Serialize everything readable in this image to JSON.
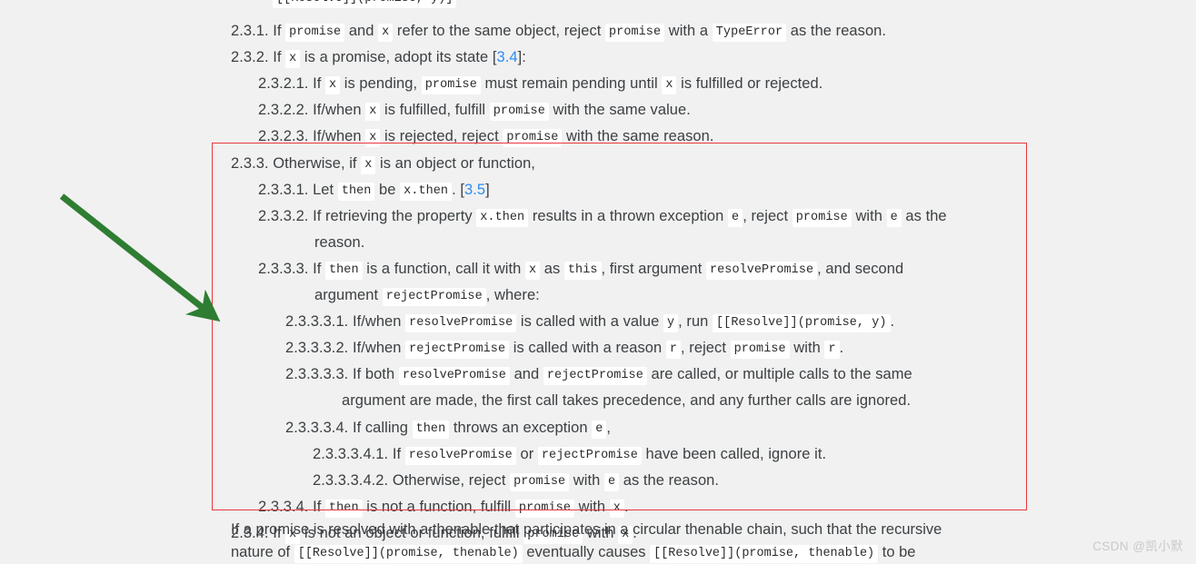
{
  "document": {
    "background_color": "#f1f1f1",
    "text_color": "#3c4043",
    "link_color": "#2e8bf0",
    "code_chip_bg": "#ffffff"
  },
  "cut_top_line": {
    "text_fragment": "[[Resolve]](promise, y)]"
  },
  "spec_items": [
    {
      "id": "2.3.1",
      "indent": 1,
      "number": "2.3.1.",
      "parts": [
        {
          "t": "text",
          "v": "If "
        },
        {
          "t": "code",
          "v": "promise"
        },
        {
          "t": "text",
          "v": " and "
        },
        {
          "t": "code",
          "v": "x"
        },
        {
          "t": "text",
          "v": " refer to the same object, reject "
        },
        {
          "t": "code",
          "v": "promise"
        },
        {
          "t": "text",
          "v": " with a "
        },
        {
          "t": "code",
          "v": "TypeError"
        },
        {
          "t": "text",
          "v": " as the reason."
        }
      ]
    },
    {
      "id": "2.3.2",
      "indent": 1,
      "number": "2.3.2.",
      "parts": [
        {
          "t": "text",
          "v": "If "
        },
        {
          "t": "code",
          "v": "x"
        },
        {
          "t": "text",
          "v": " is a promise, adopt its state ["
        },
        {
          "t": "link",
          "v": "3.4"
        },
        {
          "t": "text",
          "v": "]:"
        }
      ]
    },
    {
      "id": "2.3.2.1",
      "indent": 2,
      "number": "2.3.2.1.",
      "parts": [
        {
          "t": "text",
          "v": "If "
        },
        {
          "t": "code",
          "v": "x"
        },
        {
          "t": "text",
          "v": " is pending, "
        },
        {
          "t": "code",
          "v": "promise"
        },
        {
          "t": "text",
          "v": " must remain pending until "
        },
        {
          "t": "code",
          "v": "x"
        },
        {
          "t": "text",
          "v": " is fulfilled or rejected."
        }
      ]
    },
    {
      "id": "2.3.2.2",
      "indent": 2,
      "number": "2.3.2.2.",
      "parts": [
        {
          "t": "text",
          "v": "If/when "
        },
        {
          "t": "code",
          "v": "x"
        },
        {
          "t": "text",
          "v": " is fulfilled, fulfill "
        },
        {
          "t": "code",
          "v": "promise"
        },
        {
          "t": "text",
          "v": " with the same value."
        }
      ]
    },
    {
      "id": "2.3.2.3",
      "indent": 2,
      "number": "2.3.2.3.",
      "parts": [
        {
          "t": "text",
          "v": "If/when "
        },
        {
          "t": "code",
          "v": "x"
        },
        {
          "t": "text",
          "v": " is rejected, reject "
        },
        {
          "t": "code",
          "v": "promise"
        },
        {
          "t": "text",
          "v": " with the same reason."
        }
      ]
    },
    {
      "id": "2.3.3",
      "indent": 1,
      "number": "2.3.3.",
      "parts": [
        {
          "t": "text",
          "v": "Otherwise, if "
        },
        {
          "t": "code",
          "v": "x"
        },
        {
          "t": "text",
          "v": " is an object or function,"
        }
      ]
    },
    {
      "id": "2.3.3.1",
      "indent": 2,
      "number": "2.3.3.1.",
      "parts": [
        {
          "t": "text",
          "v": "Let "
        },
        {
          "t": "code",
          "v": "then"
        },
        {
          "t": "text",
          "v": " be "
        },
        {
          "t": "code",
          "v": "x.then"
        },
        {
          "t": "text",
          "v": ". ["
        },
        {
          "t": "link",
          "v": "3.5"
        },
        {
          "t": "text",
          "v": "]"
        }
      ]
    },
    {
      "id": "2.3.3.2",
      "indent": 2,
      "number": "2.3.3.2.",
      "parts": [
        {
          "t": "text",
          "v": "If retrieving the property "
        },
        {
          "t": "code",
          "v": "x.then"
        },
        {
          "t": "text",
          "v": " results in a thrown exception "
        },
        {
          "t": "code",
          "v": "e"
        },
        {
          "t": "text",
          "v": ", reject "
        },
        {
          "t": "code",
          "v": "promise"
        },
        {
          "t": "text",
          "v": " with "
        },
        {
          "t": "code",
          "v": "e"
        },
        {
          "t": "text",
          "v": " as the"
        }
      ]
    },
    {
      "id": "2.3.3.2-cont",
      "indent": 2,
      "continuation": true,
      "number": "",
      "parts": [
        {
          "t": "text",
          "v": "reason."
        }
      ]
    },
    {
      "id": "2.3.3.3",
      "indent": 2,
      "number": "2.3.3.3.",
      "parts": [
        {
          "t": "text",
          "v": "If "
        },
        {
          "t": "code",
          "v": "then"
        },
        {
          "t": "text",
          "v": " is a function, call it with "
        },
        {
          "t": "code",
          "v": "x"
        },
        {
          "t": "text",
          "v": " as "
        },
        {
          "t": "code",
          "v": "this"
        },
        {
          "t": "text",
          "v": ", first argument "
        },
        {
          "t": "code",
          "v": "resolvePromise"
        },
        {
          "t": "text",
          "v": ", and second"
        }
      ]
    },
    {
      "id": "2.3.3.3-cont",
      "indent": 2,
      "continuation": true,
      "number": "",
      "parts": [
        {
          "t": "text",
          "v": "argument "
        },
        {
          "t": "code",
          "v": "rejectPromise"
        },
        {
          "t": "text",
          "v": ", where:"
        }
      ]
    },
    {
      "id": "2.3.3.3.1",
      "indent": 3,
      "number": "2.3.3.3.1.",
      "parts": [
        {
          "t": "text",
          "v": "If/when "
        },
        {
          "t": "code",
          "v": "resolvePromise"
        },
        {
          "t": "text",
          "v": " is called with a value "
        },
        {
          "t": "code",
          "v": "y"
        },
        {
          "t": "text",
          "v": ", run "
        },
        {
          "t": "code",
          "v": "[[Resolve]](promise, y)"
        },
        {
          "t": "text",
          "v": "."
        }
      ]
    },
    {
      "id": "2.3.3.3.2",
      "indent": 3,
      "number": "2.3.3.3.2.",
      "parts": [
        {
          "t": "text",
          "v": "If/when "
        },
        {
          "t": "code",
          "v": "rejectPromise"
        },
        {
          "t": "text",
          "v": " is called with a reason "
        },
        {
          "t": "code",
          "v": "r"
        },
        {
          "t": "text",
          "v": ", reject "
        },
        {
          "t": "code",
          "v": "promise"
        },
        {
          "t": "text",
          "v": " with "
        },
        {
          "t": "code",
          "v": "r"
        },
        {
          "t": "text",
          "v": "."
        }
      ]
    },
    {
      "id": "2.3.3.3.3",
      "indent": 3,
      "number": "2.3.3.3.3.",
      "parts": [
        {
          "t": "text",
          "v": "If both "
        },
        {
          "t": "code",
          "v": "resolvePromise"
        },
        {
          "t": "text",
          "v": " and "
        },
        {
          "t": "code",
          "v": "rejectPromise"
        },
        {
          "t": "text",
          "v": " are called, or multiple calls to the same"
        }
      ]
    },
    {
      "id": "2.3.3.3.3-cont",
      "indent": 3,
      "continuation": true,
      "number": "",
      "parts": [
        {
          "t": "text",
          "v": "argument are made, the first call takes precedence, and any further calls are ignored."
        }
      ]
    },
    {
      "id": "2.3.3.3.4",
      "indent": 3,
      "number": "2.3.3.3.4.",
      "parts": [
        {
          "t": "text",
          "v": "If calling "
        },
        {
          "t": "code",
          "v": "then"
        },
        {
          "t": "text",
          "v": " throws an exception "
        },
        {
          "t": "code",
          "v": "e"
        },
        {
          "t": "text",
          "v": ","
        }
      ]
    },
    {
      "id": "2.3.3.3.4.1",
      "indent": 4,
      "number": "2.3.3.3.4.1.",
      "parts": [
        {
          "t": "text",
          "v": "If "
        },
        {
          "t": "code",
          "v": "resolvePromise"
        },
        {
          "t": "text",
          "v": " or "
        },
        {
          "t": "code",
          "v": "rejectPromise"
        },
        {
          "t": "text",
          "v": " have been called, ignore it."
        }
      ]
    },
    {
      "id": "2.3.3.3.4.2",
      "indent": 4,
      "number": "2.3.3.3.4.2.",
      "parts": [
        {
          "t": "text",
          "v": "Otherwise, reject "
        },
        {
          "t": "code",
          "v": "promise"
        },
        {
          "t": "text",
          "v": " with "
        },
        {
          "t": "code",
          "v": "e"
        },
        {
          "t": "text",
          "v": " as the reason."
        }
      ]
    },
    {
      "id": "2.3.3.4",
      "indent": 2,
      "number": "2.3.3.4.",
      "parts": [
        {
          "t": "text",
          "v": "If "
        },
        {
          "t": "code",
          "v": "then"
        },
        {
          "t": "text",
          "v": " is not a function, fulfill "
        },
        {
          "t": "code",
          "v": "promise"
        },
        {
          "t": "text",
          "v": " with "
        },
        {
          "t": "code",
          "v": "x"
        },
        {
          "t": "text",
          "v": "."
        }
      ]
    },
    {
      "id": "2.3.4",
      "indent": 1,
      "number": "2.3.4.",
      "parts": [
        {
          "t": "text",
          "v": "If "
        },
        {
          "t": "code",
          "v": "x"
        },
        {
          "t": "text",
          "v": " is not an object or function, fulfill "
        },
        {
          "t": "code",
          "v": "promise"
        },
        {
          "t": "text",
          "v": " with "
        },
        {
          "t": "code",
          "v": "x"
        },
        {
          "t": "text",
          "v": "."
        }
      ]
    }
  ],
  "trailing_paragraph": {
    "lines": [
      [
        {
          "t": "text",
          "v": "If a promise is resolved with a thenable that participates in a circular thenable chain, such that the recursive"
        }
      ],
      [
        {
          "t": "text",
          "v": "nature of "
        },
        {
          "t": "code",
          "v": "[[Resolve]](promise, thenable)"
        },
        {
          "t": "text",
          "v": " eventually causes "
        },
        {
          "t": "code",
          "v": "[[Resolve]](promise, thenable)"
        },
        {
          "t": "text",
          "v": " to be"
        }
      ]
    ]
  },
  "annotations": {
    "red_box": {
      "color": "#e8383d",
      "label": "highlight-rectangle"
    },
    "green_arrow": {
      "color": "#2e7d32",
      "label": "pointer-arrow"
    }
  },
  "watermark": {
    "text": "CSDN @凯小默"
  }
}
